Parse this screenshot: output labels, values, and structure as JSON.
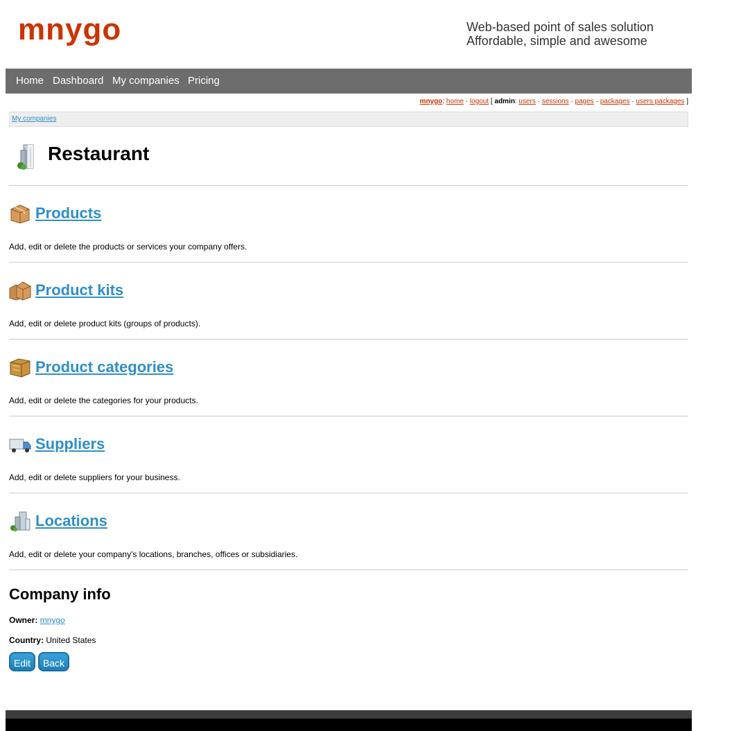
{
  "header": {
    "logo": "mnygo",
    "tagline_line1": "Web-based point of sales solution",
    "tagline_line2": "Affordable, simple and awesome"
  },
  "nav": {
    "items": [
      "Home",
      "Dashboard",
      "My companies",
      "Pricing"
    ]
  },
  "adminbar": {
    "brand": "mnygo",
    "home": "home",
    "logout": "logout",
    "admin_label": "admin",
    "links": [
      "users",
      "sessions",
      "pages",
      "packages",
      "users packages"
    ]
  },
  "breadcrumb": {
    "link": "My companies"
  },
  "page": {
    "title": "Restaurant"
  },
  "sections": [
    {
      "title": "Products",
      "desc": "Add, edit or delete the products or services your company offers.",
      "icon": "package-icon"
    },
    {
      "title": "Product kits",
      "desc": "Add, edit or delete product kits (groups of products).",
      "icon": "packages-icon"
    },
    {
      "title": "Product categories",
      "desc": "Add, edit or delete the categories for your products.",
      "icon": "box-icon"
    },
    {
      "title": "Suppliers",
      "desc": "Add, edit or delete suppliers for your business.",
      "icon": "truck-icon"
    },
    {
      "title": "Locations",
      "desc": "Add, edit or delete your company's locations, branches, offices or subsidiaries.",
      "icon": "buildings-icon"
    }
  ],
  "company_info": {
    "heading": "Company info",
    "owner_label": "Owner:",
    "owner_value": "mnygo",
    "country_label": "Country:",
    "country_value": "United States"
  },
  "buttons": {
    "edit": "Edit",
    "back": "Back"
  },
  "colors": {
    "brand": "#cc3300",
    "link": "#2f8fc8",
    "navbar": "#6d6d6d"
  }
}
